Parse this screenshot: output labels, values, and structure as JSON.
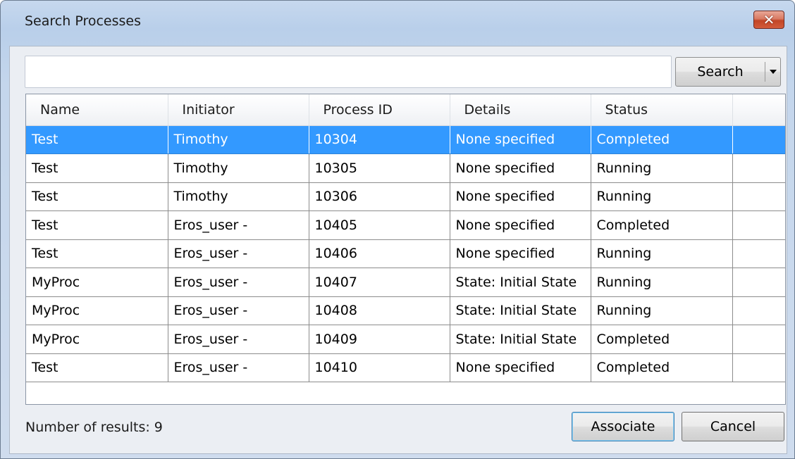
{
  "window": {
    "title": "Search Processes",
    "close_glyph": "✕"
  },
  "search": {
    "value": "",
    "placeholder": "",
    "button_label": "Search"
  },
  "table": {
    "columns": [
      "Name",
      "Initiator",
      "Process ID",
      "Details",
      "Status",
      ""
    ],
    "rows": [
      {
        "name": "Test",
        "initiator": "Timothy",
        "pid": "10304",
        "details": "None specified",
        "status": "Completed",
        "selected": true
      },
      {
        "name": "Test",
        "initiator": "Timothy",
        "pid": "10305",
        "details": "None specified",
        "status": "Running"
      },
      {
        "name": "Test",
        "initiator": "Timothy",
        "pid": "10306",
        "details": "None specified",
        "status": "Running"
      },
      {
        "name": "Test",
        "initiator": "Eros_user -",
        "pid": "10405",
        "details": "None specified",
        "status": "Completed"
      },
      {
        "name": "Test",
        "initiator": "Eros_user -",
        "pid": "10406",
        "details": "None specified",
        "status": "Running"
      },
      {
        "name": "MyProc",
        "initiator": "Eros_user -",
        "pid": "10407",
        "details": "State: Initial State",
        "status": "Running"
      },
      {
        "name": "MyProc",
        "initiator": "Eros_user -",
        "pid": "10408",
        "details": "State: Initial State",
        "status": "Running"
      },
      {
        "name": "MyProc",
        "initiator": "Eros_user -",
        "pid": "10409",
        "details": "State: Initial State",
        "status": "Completed"
      },
      {
        "name": "Test",
        "initiator": "Eros_user -",
        "pid": "10410",
        "details": "None specified",
        "status": "Completed"
      }
    ]
  },
  "footer": {
    "results_label": "Number of results: 9",
    "associate_label": "Associate",
    "cancel_label": "Cancel"
  },
  "colors": {
    "selection": "#3399ff",
    "close_button": "#c24526",
    "default_button_border": "#3c7fb1"
  }
}
